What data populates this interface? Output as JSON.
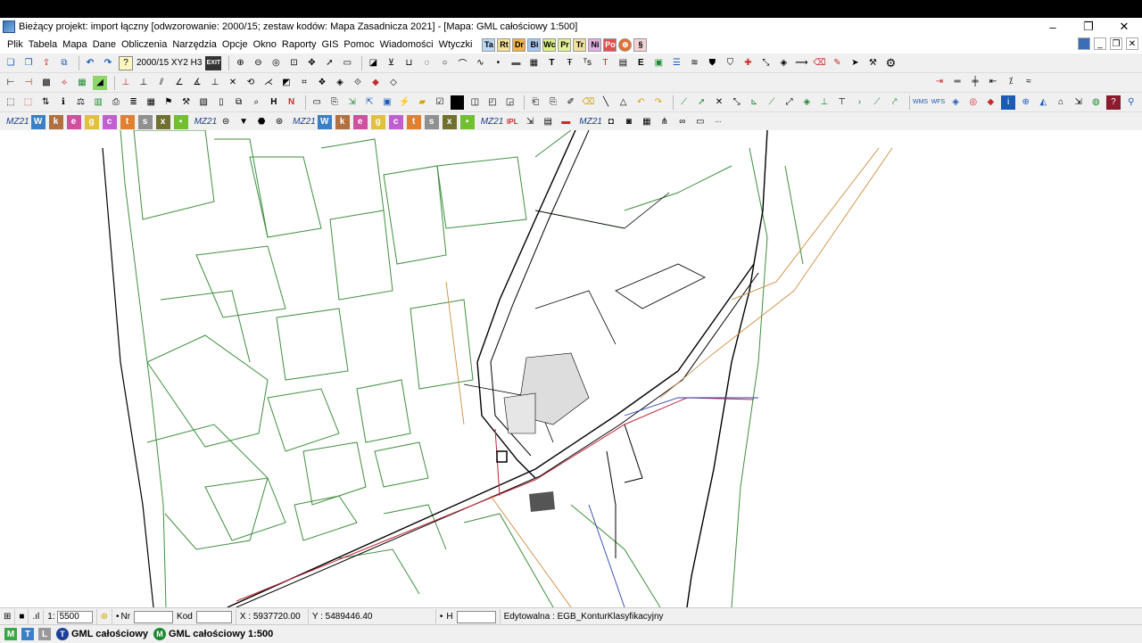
{
  "window": {
    "title": "Bieżący projekt: import łączny [odwzorowanie: 2000/15; zestaw kodów: Mapa Zasadnicza 2021] - [Mapa: GML całościowy  1:500]",
    "controls": [
      "–",
      "❐",
      "✕"
    ]
  },
  "menu": {
    "items": [
      "Plik",
      "Tabela",
      "Mapa",
      "Dane",
      "Obliczenia",
      "Narzędzia",
      "Opcje",
      "Okno",
      "Raporty",
      "GIS",
      "Pomoc",
      "Wiadomości",
      "Wtyczki"
    ],
    "quick_icons": [
      "Ta",
      "Rt",
      "Dr",
      "Bi",
      "Wc",
      "Pr",
      "Tr",
      "Ni",
      "Po"
    ]
  },
  "toolbar1": {
    "crs_label": "2000/15 XY2 H3",
    "exit_label": "EXIT"
  },
  "mz_label": "MZ21",
  "status": {
    "scale_prefix": "1:",
    "scale_value": "5500",
    "nr_label": "Nr",
    "nr_value": "",
    "kod_label": "Kod",
    "kod_value": "",
    "x_readout": "X : 5937720.00",
    "y_readout": "Y : 5489446.40",
    "h_label": "H",
    "h_value": "",
    "editable": "Edytowalna : EGB_KonturKlasyfikacyjny"
  },
  "tabs": {
    "items": [
      {
        "icon": "T",
        "label": "GML całościowy",
        "color": "#1d3f9a"
      },
      {
        "icon": "M",
        "label": "GML całościowy  1:500",
        "color": "#1c8a2e"
      }
    ]
  },
  "colors": {
    "parcel_lines": "#3f8f3f",
    "road_lines": "#000000",
    "utility_red": "#c0283a",
    "utility_orange": "#c9822a",
    "utility_blue": "#2c3fb0"
  }
}
